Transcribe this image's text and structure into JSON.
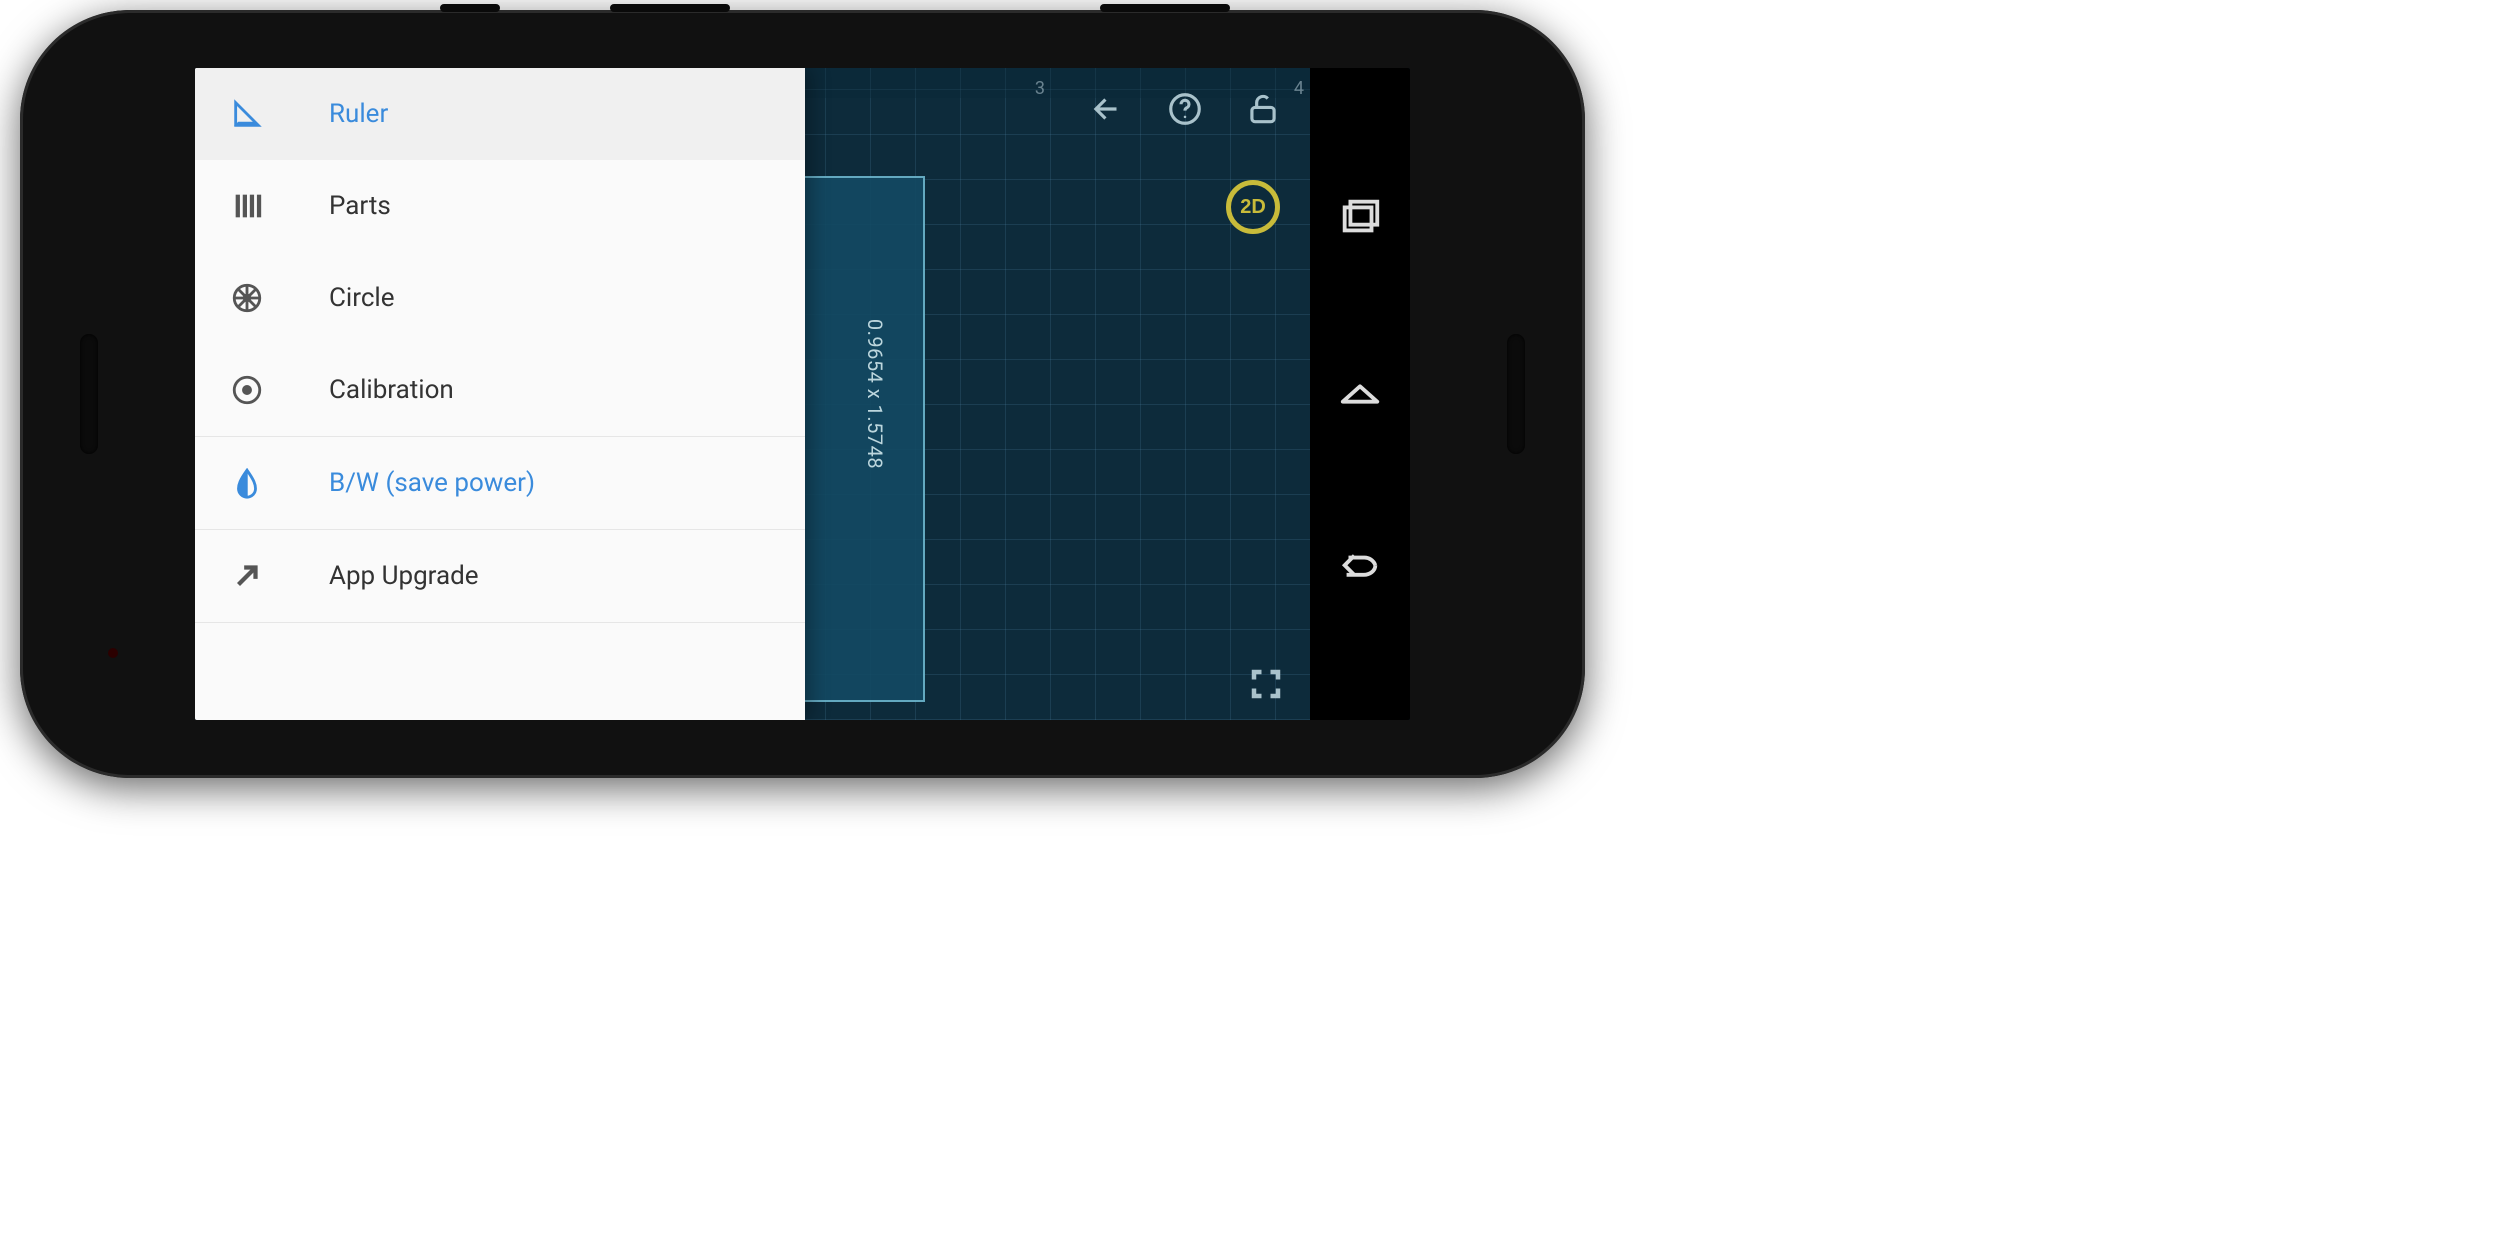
{
  "drawer": {
    "items": [
      {
        "label": "Ruler",
        "icon": "ruler-triangle-icon",
        "selected": true
      },
      {
        "label": "Parts",
        "icon": "parts-icon",
        "selected": false
      },
      {
        "label": "Circle",
        "icon": "wheel-icon",
        "selected": false
      },
      {
        "label": "Calibration",
        "icon": "target-icon",
        "selected": false
      },
      {
        "label": "B/W (save power)",
        "icon": "drop-icon",
        "selected": false,
        "accent": true
      },
      {
        "label": "App Upgrade",
        "icon": "arrow-upright-icon",
        "selected": false
      }
    ]
  },
  "canvas": {
    "measurement_label": "0.9654 x 1.5748",
    "top_ruler_ticks": {
      "r1": "3",
      "r2": "4"
    },
    "badge": "2D"
  },
  "colors": {
    "accent": "#3a8bdc",
    "badge": "#c8bb3a",
    "bg": "#0d2b3b"
  }
}
